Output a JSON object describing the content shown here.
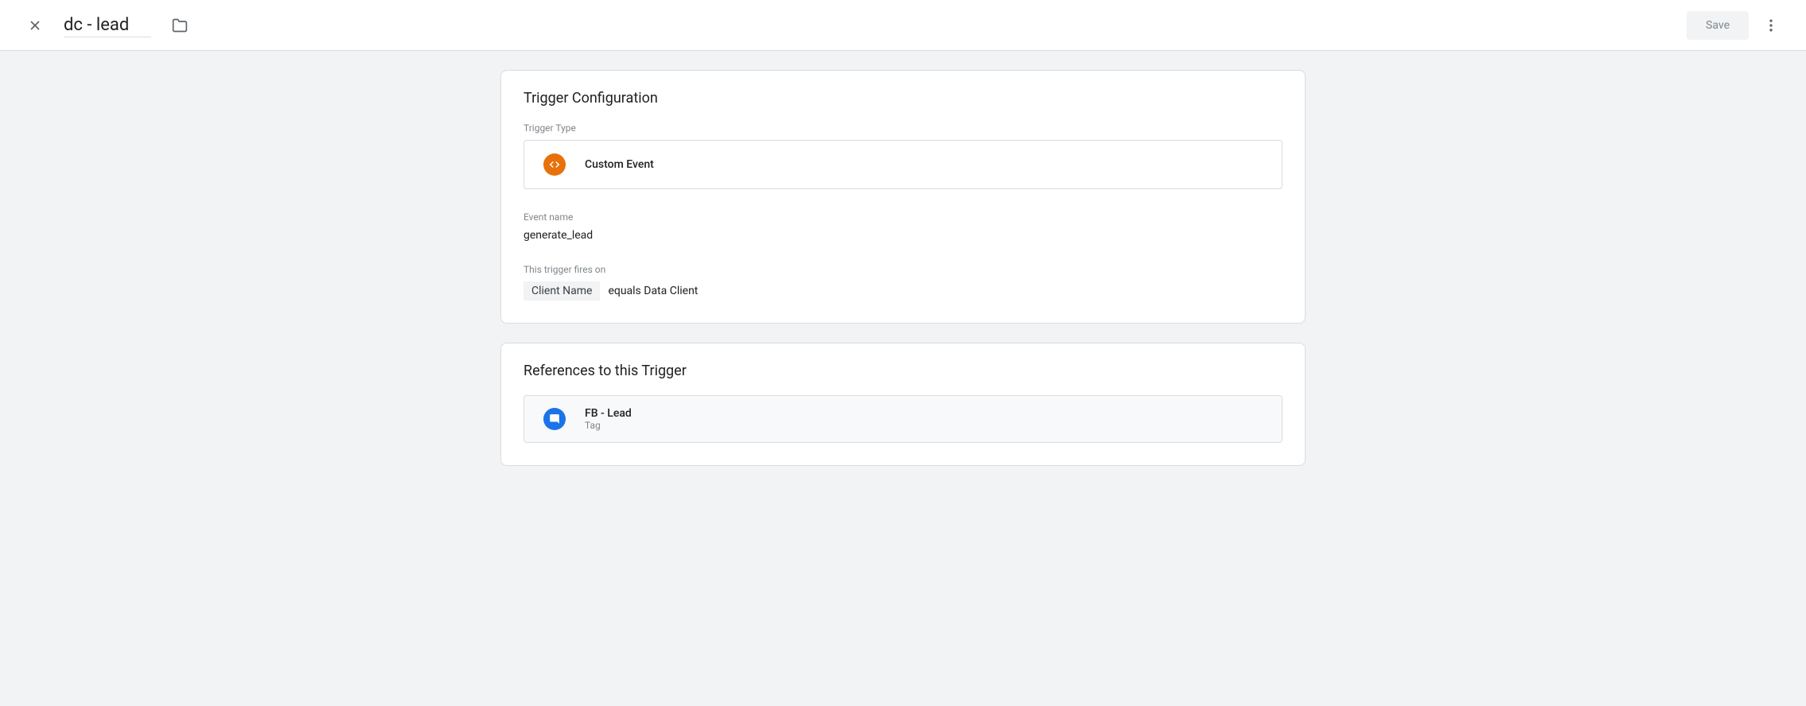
{
  "header": {
    "title_value": "dc - lead",
    "save_label": "Save"
  },
  "trigger_config": {
    "card_title": "Trigger Configuration",
    "trigger_type_label": "Trigger Type",
    "trigger_type_name": "Custom Event",
    "event_name_label": "Event name",
    "event_name_value": "generate_lead",
    "fires_on_label": "This trigger fires on",
    "condition_variable": "Client Name",
    "condition_text": "equals Data Client"
  },
  "references": {
    "card_title": "References to this Trigger",
    "items": [
      {
        "name": "FB - Lead",
        "type": "Tag"
      }
    ]
  }
}
